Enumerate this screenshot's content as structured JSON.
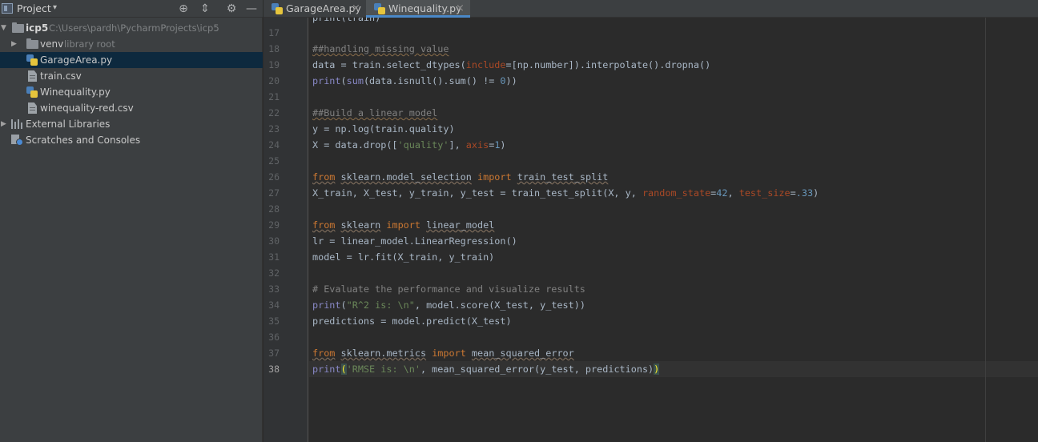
{
  "project_panel": {
    "title": "Project",
    "caret": "▾",
    "buttons": {
      "locate": "⊕",
      "collapse": "⇕",
      "settings": "⚙",
      "hide": "—"
    },
    "tree": {
      "root": {
        "label": "icp5",
        "path": "C:\\Users\\pardh\\PycharmProjects\\icp5"
      },
      "venv": {
        "label": "venv",
        "note": "library root"
      },
      "files": [
        {
          "label": "GarageArea.py",
          "icon": "python-file-icon",
          "selected": true
        },
        {
          "label": "train.csv",
          "icon": "csv-file-icon",
          "selected": false
        },
        {
          "label": "Winequality.py",
          "icon": "python-file-icon",
          "selected": false
        },
        {
          "label": "winequality-red.csv",
          "icon": "csv-file-icon",
          "selected": false
        }
      ],
      "external_libraries": "External Libraries",
      "scratches": "Scratches and Consoles"
    }
  },
  "tabs": [
    {
      "label": "GarageArea.py",
      "active": false,
      "close": "×"
    },
    {
      "label": "Winequality.py",
      "active": true,
      "close": "×"
    }
  ],
  "editor": {
    "current_line": 38,
    "line_numbers": [
      "17",
      "18",
      "19",
      "20",
      "21",
      "22",
      "23",
      "24",
      "25",
      "26",
      "27",
      "28",
      "29",
      "30",
      "31",
      "32",
      "33",
      "34",
      "35",
      "36",
      "37",
      "38"
    ],
    "lines": [
      [
        {
          "t": "print(",
          "c": "c-bi0"
        },
        {
          "t": "train",
          "c": ""
        },
        {
          "t": ")",
          "c": ""
        }
      ],
      [],
      [
        {
          "t": "##handling missing value",
          "c": "c-com typo"
        }
      ],
      [
        {
          "t": "data = train.select_dtypes(",
          "c": ""
        },
        {
          "t": "include",
          "c": "c-kwarg"
        },
        {
          "t": "=[np.number]).interpolate().dropna()",
          "c": ""
        }
      ],
      [
        {
          "t": "print",
          "c": "c-bi"
        },
        {
          "t": "(",
          "c": ""
        },
        {
          "t": "sum",
          "c": "c-bi"
        },
        {
          "t": "(data.isnull().sum() != ",
          "c": ""
        },
        {
          "t": "0",
          "c": "c-num"
        },
        {
          "t": "))",
          "c": ""
        }
      ],
      [],
      [
        {
          "t": "##Build a linear model",
          "c": "c-com typo"
        }
      ],
      [
        {
          "t": "y = np.log(train.quality)",
          "c": ""
        }
      ],
      [
        {
          "t": "X = data.drop([",
          "c": ""
        },
        {
          "t": "'quality'",
          "c": "c-str"
        },
        {
          "t": "], ",
          "c": ""
        },
        {
          "t": "axis",
          "c": "c-kwarg"
        },
        {
          "t": "=",
          "c": ""
        },
        {
          "t": "1",
          "c": "c-num"
        },
        {
          "t": ")",
          "c": ""
        }
      ],
      [],
      [
        {
          "t": "from",
          "c": "c-kw typo-k"
        },
        {
          "t": " ",
          "c": ""
        },
        {
          "t": "sklearn.model_selection",
          "c": "c-id typo"
        },
        {
          "t": " ",
          "c": ""
        },
        {
          "t": "import",
          "c": "c-kw"
        },
        {
          "t": " ",
          "c": ""
        },
        {
          "t": "train_test_split",
          "c": "c-id typo"
        }
      ],
      [
        {
          "t": "X_train, X_test, y_train, y_test = train_test_split(X, y, ",
          "c": ""
        },
        {
          "t": "random_state",
          "c": "c-kwarg"
        },
        {
          "t": "=",
          "c": ""
        },
        {
          "t": "42",
          "c": "c-num"
        },
        {
          "t": ", ",
          "c": ""
        },
        {
          "t": "test_size",
          "c": "c-kwarg"
        },
        {
          "t": "=",
          "c": ""
        },
        {
          "t": ".33",
          "c": "c-num"
        },
        {
          "t": ")",
          "c": ""
        }
      ],
      [],
      [
        {
          "t": "from",
          "c": "c-kw typo-k"
        },
        {
          "t": " ",
          "c": ""
        },
        {
          "t": "sklearn",
          "c": "c-id typo"
        },
        {
          "t": " ",
          "c": ""
        },
        {
          "t": "import",
          "c": "c-kw"
        },
        {
          "t": " ",
          "c": ""
        },
        {
          "t": "linear_model",
          "c": "c-id typo"
        }
      ],
      [
        {
          "t": "lr = linear_model.LinearRegression()",
          "c": ""
        }
      ],
      [
        {
          "t": "model = lr.fit(X_train, y_train)",
          "c": ""
        }
      ],
      [],
      [
        {
          "t": "# Evaluate the performance and visualize results",
          "c": "c-com"
        }
      ],
      [
        {
          "t": "print",
          "c": "c-bi"
        },
        {
          "t": "(",
          "c": ""
        },
        {
          "t": "\"R^2 is: \\n\"",
          "c": "c-str"
        },
        {
          "t": ", model.score(X_test, y_test))",
          "c": ""
        }
      ],
      [
        {
          "t": "predictions = model.predict(X_test)",
          "c": ""
        }
      ],
      [],
      [
        {
          "t": "from",
          "c": "c-kw typo-k"
        },
        {
          "t": " ",
          "c": ""
        },
        {
          "t": "sklearn.metrics",
          "c": "c-id typo"
        },
        {
          "t": " ",
          "c": ""
        },
        {
          "t": "import",
          "c": "c-kw"
        },
        {
          "t": " ",
          "c": ""
        },
        {
          "t": "mean_squared_error",
          "c": "c-id typo"
        }
      ],
      [
        {
          "t": "print",
          "c": "c-bi"
        },
        {
          "t": "(",
          "c": "c-paren-hl"
        },
        {
          "t": "'RMSE is: \\n'",
          "c": "c-str"
        },
        {
          "t": ", mean_squared_error(y_test, predictions)",
          "c": ""
        },
        {
          "t": ")",
          "c": "c-paren-hl"
        }
      ]
    ]
  },
  "colors": {
    "panel_bg": "#3c3f41",
    "editor_bg": "#2b2b2b",
    "selection": "#0d293e",
    "keyword": "#cc7832",
    "string": "#6a8759",
    "number": "#6897bb",
    "comment": "#808080"
  }
}
